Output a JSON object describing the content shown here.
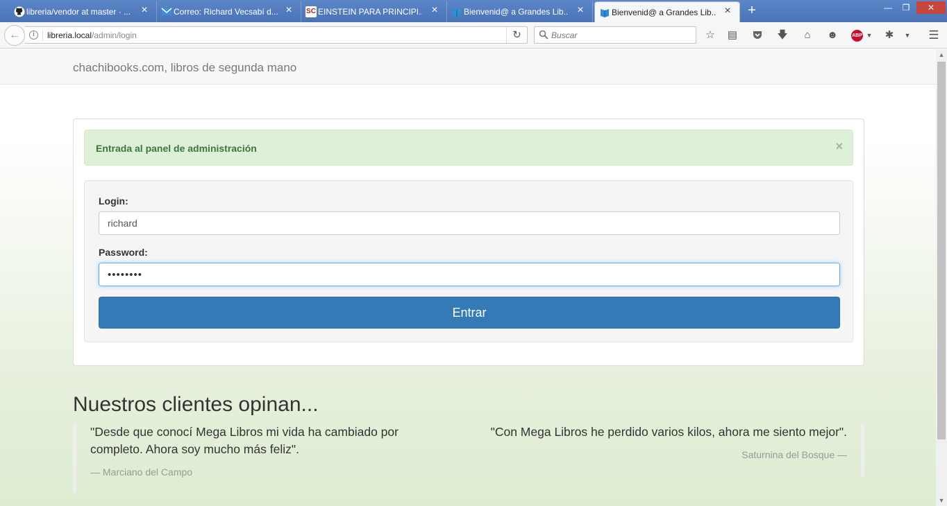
{
  "browser": {
    "tabs": [
      {
        "title": "libreria/vendor at master · ...",
        "icon": "github-icon"
      },
      {
        "title": "Correo: Richard Vecsabí d...",
        "icon": "mail-icon"
      },
      {
        "title": "EINSTEIN PARA PRINCIPI...",
        "icon": "sc-icon",
        "icon_text": "SC"
      },
      {
        "title": "Bienvenid@ a Grandes Lib...",
        "icon": "book-icon"
      },
      {
        "title": "Bienvenid@ a Grandes Lib...",
        "icon": "book-icon",
        "active": true
      }
    ],
    "url_host": "libreria.local",
    "url_path": "/admin/login",
    "search_placeholder": "Buscar",
    "abp_label": "ABP"
  },
  "site": {
    "brand": "chachibooks.com, libros de segunda mano"
  },
  "login": {
    "alert": "Entrada al panel de administración",
    "alert_close": "×",
    "login_label": "Login:",
    "login_value": "richard",
    "password_label": "Password:",
    "password_value": "••••••••",
    "submit_label": "Entrar"
  },
  "testimonials": {
    "title": "Nuestros clientes opinan...",
    "items": [
      {
        "quote": "\"Desde que conocí Mega Libros mi vida ha cambiado por completo. Ahora soy mucho más feliz\".",
        "author": "— Marciano del Campo"
      },
      {
        "quote": "\"Con Mega Libros he perdido varios kilos, ahora me siento mejor\".",
        "author": "Saturnina del Bosque —"
      }
    ]
  },
  "colors": {
    "tabstrip": "#4a73b6",
    "alert_bg": "#dff0d8",
    "alert_text": "#3c763d",
    "primary": "#337ab7"
  }
}
